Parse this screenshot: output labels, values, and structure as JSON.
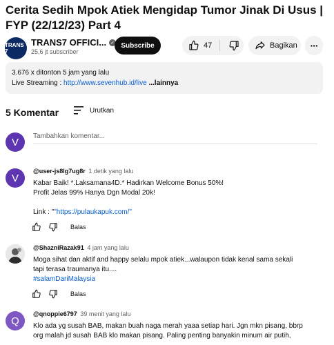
{
  "video": {
    "title": "Cerita Sedih Mpok Atiek Mengidap Tumor Jinak Di Usus | FYP (22/12/23) Part 4"
  },
  "channel": {
    "logo_text": "TRANS 7",
    "name": "TRANS7 OFFICI...",
    "subscribers": "25,6 jt subscriber",
    "subscribe_label": "Subscribe"
  },
  "actions": {
    "like_count": "47",
    "share_label": "Bagikan"
  },
  "description": {
    "views_time": "3.676 x ditonton  5 jam yang lalu",
    "line2_prefix": "Live Streaming : ",
    "line2_link": "http://www.sevenhub.id/live",
    "line2_more": " ...lainnya"
  },
  "comments_header": {
    "count": "5 Komentar",
    "sort_label": "Urutkan",
    "add_placeholder": "Tambahkan komentar...",
    "self_avatar": "V",
    "self_avatar_color": "#5e35b1"
  },
  "comments": [
    {
      "author": "@user-js8lg7ug8r",
      "time": "1 detik yang lalu",
      "avatar": "V",
      "avatar_color": "#5e35b1",
      "lines": [
        "Kabar Baik! *.Laksamana4D.* Hadirkan Welcome Bonus 50%!",
        "Profit Jelas 99% Hanya Dgn Modal 20k!"
      ],
      "link_prefix": "Link  : \"",
      "link": "\"https://pulaukapuk.com/\"",
      "reply_label": "Balas"
    },
    {
      "author": "@ShazniRazak91",
      "time": "4 jam yang lalu",
      "avatar": "",
      "avatar_color": "#7a7a7a",
      "lines": [
        "Moga sihat dan aktif and happy selalu mpok atiek...walaupon  tidak kenal sama sekali",
        "tapi terasa traumanya itu...."
      ],
      "hashtag": "#salamDariMalaysia",
      "reply_label": "Balas"
    },
    {
      "author": "@qnoppie6797",
      "time": "39 menit yang lalu",
      "avatar": "Q",
      "avatar_color": "#7e57c2",
      "lines": [
        "Klo ada yg susah BAB, makan buah naga merah yaaa setiap hari. Jgn mkn pisang, bbrp",
        "org malah jd susah BAB klo makan pisang. Paling penting banyakin minum air putih,"
      ]
    }
  ]
}
